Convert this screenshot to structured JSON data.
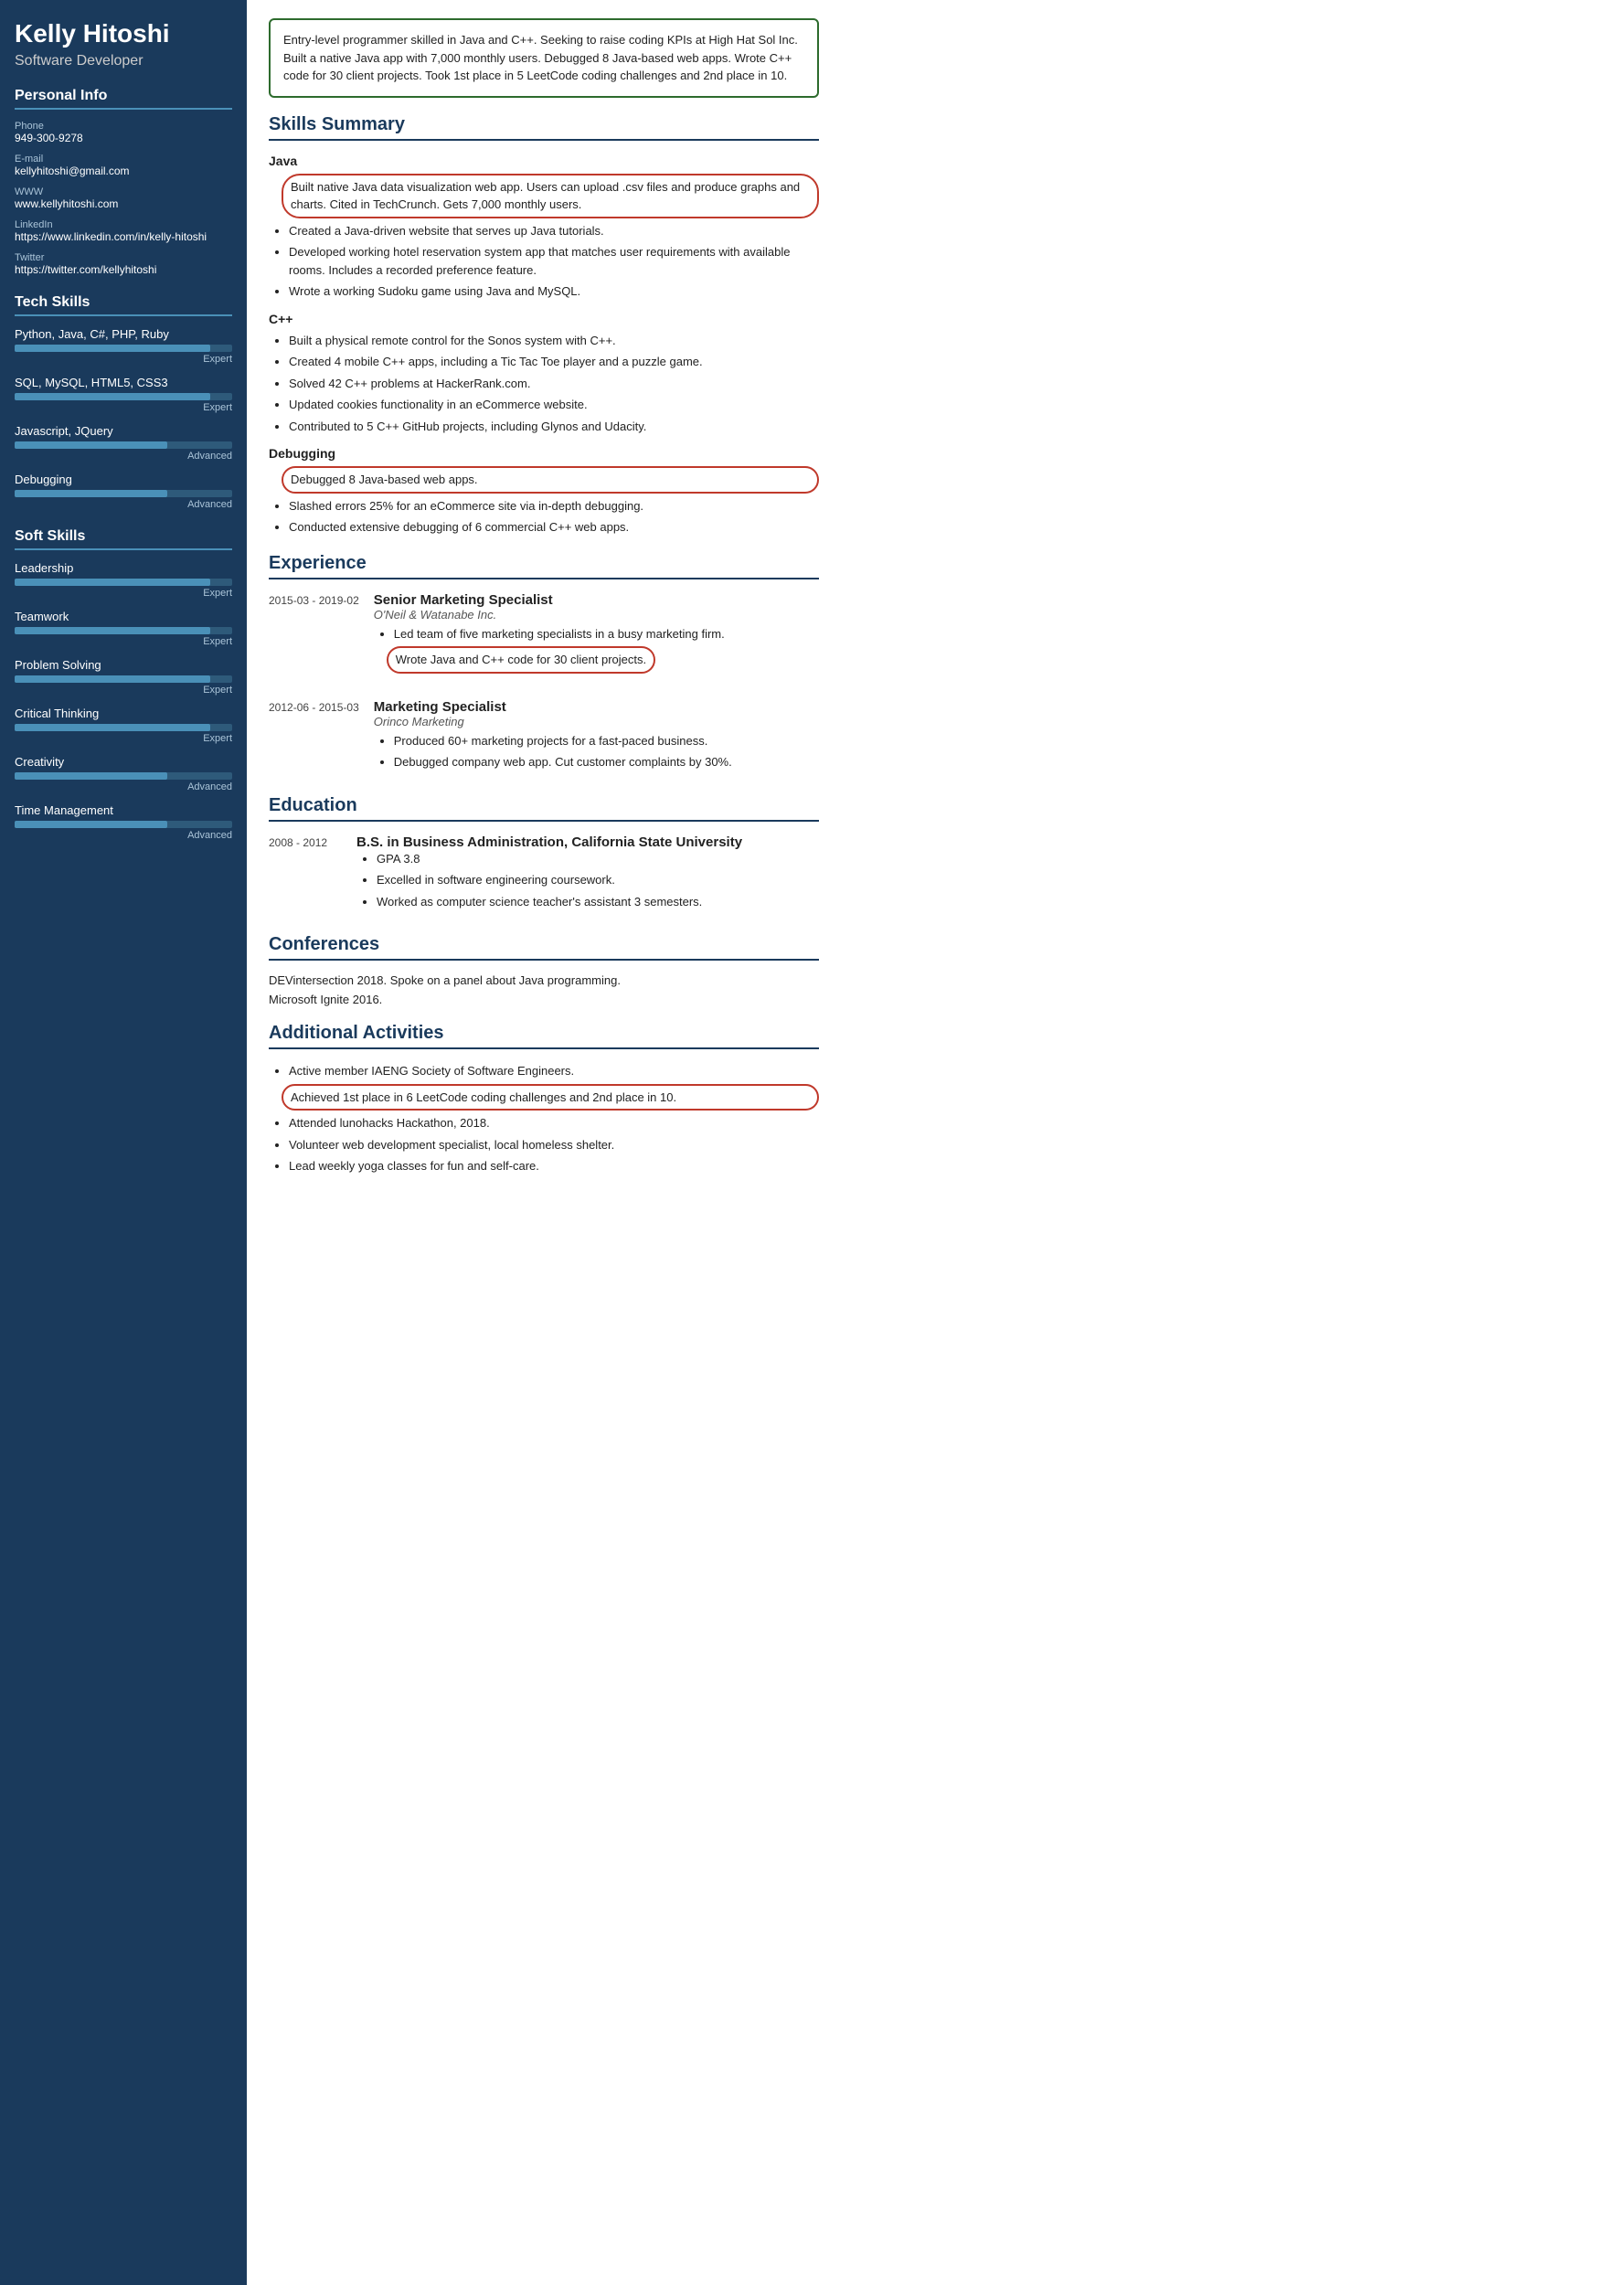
{
  "sidebar": {
    "name": "Kelly Hitoshi",
    "title": "Software Developer",
    "personal_info": {
      "section_title": "Personal Info",
      "fields": [
        {
          "label": "Phone",
          "value": "949-300-9278"
        },
        {
          "label": "E-mail",
          "value": "kellyhitoshi@gmail.com"
        },
        {
          "label": "WWW",
          "value": "www.kellyhitoshi.com"
        },
        {
          "label": "LinkedIn",
          "value": "https://www.linkedin.com/in/kelly-hitoshi"
        },
        {
          "label": "Twitter",
          "value": "https://twitter.com/kellyhitoshi"
        }
      ]
    },
    "tech_skills": {
      "section_title": "Tech Skills",
      "items": [
        {
          "name": "Python, Java, C#, PHP, Ruby",
          "level": "Expert",
          "fill_pct": 90
        },
        {
          "name": "SQL, MySQL, HTML5, CSS3",
          "level": "Expert",
          "fill_pct": 90
        },
        {
          "name": "Javascript, JQuery",
          "level": "Advanced",
          "fill_pct": 70
        },
        {
          "name": "Debugging",
          "level": "Advanced",
          "fill_pct": 70
        }
      ]
    },
    "soft_skills": {
      "section_title": "Soft Skills",
      "items": [
        {
          "name": "Leadership",
          "level": "Expert",
          "fill_pct": 90
        },
        {
          "name": "Teamwork",
          "level": "Expert",
          "fill_pct": 90
        },
        {
          "name": "Problem Solving",
          "level": "Expert",
          "fill_pct": 90
        },
        {
          "name": "Critical Thinking",
          "level": "Expert",
          "fill_pct": 90
        },
        {
          "name": "Creativity",
          "level": "Advanced",
          "fill_pct": 70
        },
        {
          "name": "Time Management",
          "level": "Advanced",
          "fill_pct": 70
        }
      ]
    }
  },
  "main": {
    "summary": "Entry-level programmer skilled in Java and C++. Seeking to raise coding KPIs at High Hat Sol Inc. Built a native Java app with 7,000 monthly users. Debugged 8 Java-based web apps. Wrote C++ code for 30 client projects. Took 1st place in 5 LeetCode coding challenges and 2nd place in 10.",
    "skills_summary": {
      "title": "Skills Summary",
      "groups": [
        {
          "name": "Java",
          "bullets": [
            {
              "text": "Built native Java data visualization web app. Users can upload .csv files and produce graphs and charts. Cited in TechCrunch. Gets 7,000 monthly users.",
              "highlight": true
            },
            {
              "text": "Created a Java-driven website that serves up Java tutorials.",
              "highlight": false
            },
            {
              "text": "Developed working hotel reservation system app that matches user requirements with available rooms. Includes a recorded preference feature.",
              "highlight": false
            },
            {
              "text": "Wrote a working Sudoku game using Java and MySQL.",
              "highlight": false
            }
          ]
        },
        {
          "name": "C++",
          "bullets": [
            {
              "text": "Built a physical remote control for the Sonos system with C++.",
              "highlight": false
            },
            {
              "text": "Created 4 mobile C++ apps, including a Tic Tac Toe player and a puzzle game.",
              "highlight": false
            },
            {
              "text": "Solved 42 C++ problems at HackerRank.com.",
              "highlight": false
            },
            {
              "text": "Updated cookies functionality in an eCommerce website.",
              "highlight": false
            },
            {
              "text": "Contributed to 5 C++ GitHub projects, including Glynos and Udacity.",
              "highlight": false
            }
          ]
        },
        {
          "name": "Debugging",
          "bullets": [
            {
              "text": "Debugged 8 Java-based web apps.",
              "highlight": true
            },
            {
              "text": "Slashed errors 25% for an eCommerce site via in-depth debugging.",
              "highlight": false
            },
            {
              "text": "Conducted extensive debugging of 6 commercial C++ web apps.",
              "highlight": false
            }
          ]
        }
      ]
    },
    "experience": {
      "title": "Experience",
      "items": [
        {
          "date": "2015-03 - 2019-02",
          "title": "Senior Marketing Specialist",
          "company": "O'Neil & Watanabe Inc.",
          "bullets": [
            {
              "text": "Led team of five marketing specialists in a busy marketing firm.",
              "highlight": false
            },
            {
              "text": "Wrote Java and C++ code for 30 client projects.",
              "highlight": true
            }
          ]
        },
        {
          "date": "2012-06 - 2015-03",
          "title": "Marketing Specialist",
          "company": "Orinco Marketing",
          "bullets": [
            {
              "text": "Produced 60+ marketing projects for a fast-paced business.",
              "highlight": false
            },
            {
              "text": "Debugged company web app. Cut customer complaints by 30%.",
              "highlight": false
            }
          ]
        }
      ]
    },
    "education": {
      "title": "Education",
      "items": [
        {
          "date": "2008 - 2012",
          "title": "B.S. in Business Administration, California State University",
          "company": "",
          "bullets": [
            {
              "text": "GPA 3.8",
              "highlight": false
            },
            {
              "text": "Excelled in software engineering coursework.",
              "highlight": false
            },
            {
              "text": "Worked as computer science teacher's assistant 3 semesters.",
              "highlight": false
            }
          ]
        }
      ]
    },
    "conferences": {
      "title": "Conferences",
      "items": [
        "DEVintersection 2018. Spoke on a panel about Java programming.",
        "Microsoft Ignite 2016."
      ]
    },
    "additional": {
      "title": "Additional Activities",
      "bullets": [
        {
          "text": "Active member IAENG Society of Software Engineers.",
          "highlight": false
        },
        {
          "text": "Achieved 1st place in 6 LeetCode coding challenges and 2nd place in 10.",
          "highlight": true
        },
        {
          "text": "Attended lunohacks Hackathon, 2018.",
          "highlight": false
        },
        {
          "text": "Volunteer web development specialist, local homeless shelter.",
          "highlight": false
        },
        {
          "text": "Lead weekly yoga classes for fun and self-care.",
          "highlight": false
        }
      ]
    }
  }
}
